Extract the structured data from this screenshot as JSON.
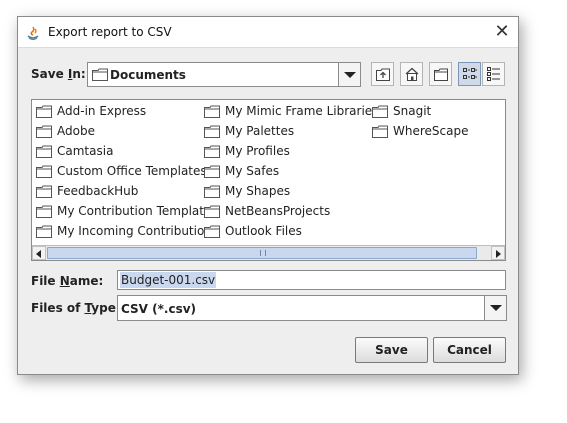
{
  "window": {
    "title": "Export report to CSV",
    "app_icon": "java-app-icon",
    "close_symbol": "✕"
  },
  "save_in": {
    "label_before": "Save ",
    "label_mnemonic": "I",
    "label_after": "n:",
    "value": "Documents"
  },
  "toolbar": {
    "icons": [
      "up-one-level-icon",
      "home-folder-icon",
      "new-folder-icon",
      "list-view-icon",
      "details-view-icon"
    ],
    "selected": "list-view-icon"
  },
  "files": {
    "columns": [
      [
        "Add-in Express",
        "Adobe",
        "Camtasia",
        "Custom Office Templates",
        "FeedbackHub",
        "My Contribution Templates",
        "My Incoming Contributions"
      ],
      [
        "My Mimic Frame Libraries",
        "My Palettes",
        "My Profiles",
        "My Safes",
        "My Shapes",
        "NetBeansProjects",
        "Outlook Files"
      ],
      [
        "Snagit",
        "WhereScape"
      ]
    ]
  },
  "file_name": {
    "label_before": "File ",
    "label_mnemonic": "N",
    "label_after": "ame:",
    "value": "Budget-001.csv"
  },
  "file_type": {
    "label_before": "Files of ",
    "label_mnemonic": "T",
    "label_after": "ype:",
    "value": "CSV (*.csv)"
  },
  "buttons": {
    "save": "Save",
    "cancel": "Cancel"
  },
  "colors": {
    "selection": "#c9d8ee",
    "dialog_bg": "#eeeeee"
  }
}
